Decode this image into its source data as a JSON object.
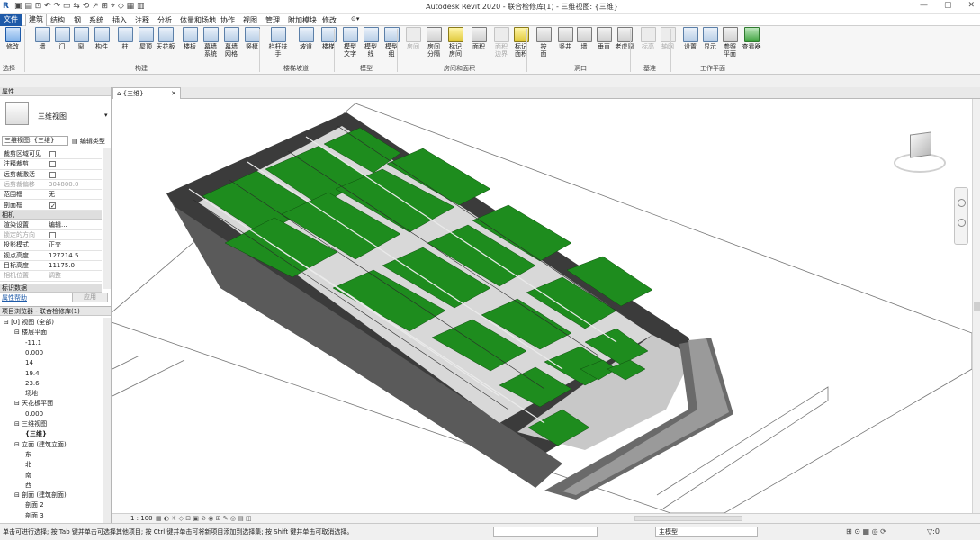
{
  "window": {
    "title": "Autodesk Revit 2020 - 联合检修库(1) - 三维视图: {三维}",
    "app_icon": "R"
  },
  "menu": {
    "items": [
      "文件",
      "建筑",
      "结构",
      "钢",
      "系统",
      "插入",
      "注释",
      "分析",
      "体量和场地",
      "协作",
      "视图",
      "管理",
      "附加模块",
      "修改"
    ],
    "active": "建筑"
  },
  "ribbon": {
    "select_group": "选择",
    "modify_label": "修改",
    "tools": [
      {
        "label": "墙"
      },
      {
        "label": "门"
      },
      {
        "label": "窗"
      },
      {
        "label": "构件"
      },
      {
        "label": "柱"
      },
      {
        "label": "屋顶"
      },
      {
        "label": "天花板"
      },
      {
        "label": "楼板"
      },
      {
        "label": "幕墙\n系统"
      },
      {
        "label": "幕墙\n网格"
      },
      {
        "label": "竖梃"
      },
      {
        "label": "栏杆扶手"
      },
      {
        "label": "坡道"
      },
      {
        "label": "楼梯"
      },
      {
        "label": "模型\n文字"
      },
      {
        "label": "模型\n线"
      },
      {
        "label": "模型\n组"
      },
      {
        "label": "房间"
      },
      {
        "label": "房间\n分隔"
      },
      {
        "label": "标记\n房间"
      },
      {
        "label": "面积"
      },
      {
        "label": "面积\n边界"
      },
      {
        "label": "标记\n面积"
      },
      {
        "label": "按\n面"
      },
      {
        "label": "竖井"
      },
      {
        "label": "墙"
      },
      {
        "label": "垂直"
      },
      {
        "label": "老虎窗"
      },
      {
        "label": "标高"
      },
      {
        "label": "轴网"
      },
      {
        "label": "设置"
      },
      {
        "label": "显示"
      },
      {
        "label": "参照\n平面"
      },
      {
        "label": "查看器"
      }
    ],
    "groups": [
      "构建",
      "楼梯坡道",
      "模型",
      "房间和面积",
      "洞口",
      "基准",
      "工作平面"
    ]
  },
  "properties": {
    "panel_title": "属性",
    "type_name": "三维视图",
    "view_selector": "三维视图: {三维}",
    "edit_type": "编辑类型",
    "rows": [
      {
        "k": "裁剪区域可见",
        "type": "cb",
        "checked": false
      },
      {
        "k": "注释裁剪",
        "type": "cb",
        "checked": false
      },
      {
        "k": "远剪裁激活",
        "type": "cb",
        "checked": false
      },
      {
        "k": "远剪裁偏移",
        "v": "304800.0",
        "dis": true
      },
      {
        "k": "范围框",
        "v": "无"
      },
      {
        "k": "剖面框",
        "type": "cb",
        "checked": true
      }
    ],
    "camera_section": "相机",
    "rows2": [
      {
        "k": "渲染设置",
        "v": "编辑..."
      },
      {
        "k": "锁定的方向",
        "type": "cb",
        "checked": false,
        "dis": true
      },
      {
        "k": "投影模式",
        "v": "正交"
      },
      {
        "k": "视点高度",
        "v": "127214.5"
      },
      {
        "k": "目标高度",
        "v": "11175.0"
      },
      {
        "k": "相机位置",
        "v": "调整",
        "dis": true
      }
    ],
    "ident_section": "标识数据",
    "help_link": "属性帮助",
    "apply": "应用"
  },
  "browser": {
    "title": "项目浏览器 - 联合检修库(1)",
    "items": [
      {
        "t": "[0] 视图 (全部)",
        "lvl": 0
      },
      {
        "t": "楼层平面",
        "lvl": 1
      },
      {
        "t": "-11.1",
        "lvl": 2
      },
      {
        "t": "0.000",
        "lvl": 2
      },
      {
        "t": "14",
        "lvl": 2
      },
      {
        "t": "19.4",
        "lvl": 2
      },
      {
        "t": "23.6",
        "lvl": 2
      },
      {
        "t": "场地",
        "lvl": 2
      },
      {
        "t": "天花板平面",
        "lvl": 1
      },
      {
        "t": "0.000",
        "lvl": 2
      },
      {
        "t": "三维视图",
        "lvl": 1
      },
      {
        "t": "{三维}",
        "lvl": 2
      },
      {
        "t": "立面 (建筑立面)",
        "lvl": 1
      },
      {
        "t": "东",
        "lvl": 2
      },
      {
        "t": "北",
        "lvl": 2
      },
      {
        "t": "南",
        "lvl": 2
      },
      {
        "t": "西",
        "lvl": 2
      },
      {
        "t": "剖面 (建筑剖面)",
        "lvl": 1
      },
      {
        "t": "剖面 2",
        "lvl": 2
      },
      {
        "t": "剖面 3",
        "lvl": 2
      }
    ]
  },
  "view": {
    "tab": "{三维}",
    "scale": "1 : 100"
  },
  "status": {
    "message": "单击可进行选择; 按 Tab 键并单击可选择其他项目; 按 Ctrl 键并单击可将新项目添加到选择集; 按 Shift 键并单击可取消选择。",
    "workset": "主模型",
    "filter_count": ":0"
  },
  "colors": {
    "floor_green": "#1e8c1e",
    "file_blue": "#1e5aa8"
  }
}
